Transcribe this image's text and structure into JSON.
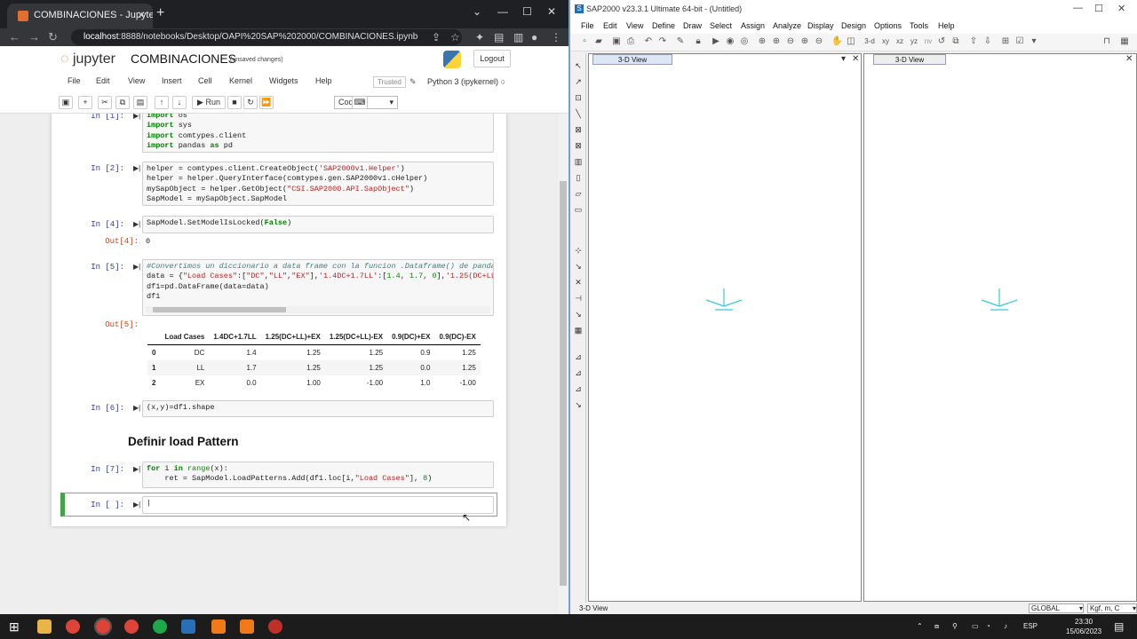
{
  "chrome": {
    "tab_title": "COMBINACIONES - Jupyter Note",
    "url_host": "localhost",
    "url_rest": ":8888/notebooks/Desktop/OAPI%20SAP%202000/COMBINACIONES.ipynb"
  },
  "jupyter": {
    "logo": "jupyter",
    "notebook_title": "COMBINACIONES",
    "save_status": "(unsaved changes)",
    "logout": "Logout",
    "menu": [
      "File",
      "Edit",
      "View",
      "Insert",
      "Cell",
      "Kernel",
      "Widgets",
      "Help"
    ],
    "trusted": "Trusted",
    "kernel": "Python 3 (ipykernel)",
    "run_label": "Run",
    "cell_type": "Code"
  },
  "cells": {
    "c1": {
      "prompt": "In [1]:"
    },
    "c2": {
      "prompt": "In [2]:"
    },
    "c4": {
      "prompt": "In [4]:",
      "out_prompt": "Out[4]:",
      "output": "0"
    },
    "c5": {
      "prompt": "In [5]:",
      "out_prompt": "Out[5]:"
    },
    "c6": {
      "prompt": "In [6]:"
    },
    "c7": {
      "prompt": "In [7]:"
    },
    "c8": {
      "prompt": "In [ ]:"
    }
  },
  "heading": "Definir load Pattern",
  "dataframe": {
    "columns": [
      "",
      "Load Cases",
      "1.4DC+1.7LL",
      "1.25(DC+LL)+EX",
      "1.25(DC+LL)-EX",
      "0.9(DC)+EX",
      "0.9(DC)-EX"
    ],
    "rows": [
      [
        "0",
        "DC",
        "1.4",
        "1.25",
        "1.25",
        "0.9",
        "1.25"
      ],
      [
        "1",
        "LL",
        "1.7",
        "1.25",
        "1.25",
        "0.0",
        "1.25"
      ],
      [
        "2",
        "EX",
        "0.0",
        "1.00",
        "-1.00",
        "1.0",
        "-1.00"
      ]
    ]
  },
  "sap": {
    "title": "SAP2000 v23.3.1 Ultimate 64-bit - (Untitled)",
    "menu": [
      "File",
      "Edit",
      "View",
      "Define",
      "Draw",
      "Select",
      "Assign",
      "Analyze",
      "Display",
      "Design",
      "Options",
      "Tools",
      "Help"
    ],
    "view_tab_1": "3-D View",
    "view_tab_2": "3-D View",
    "status_left": "3-D View",
    "coord_system": "GLOBAL",
    "units": "Kgf, m, C"
  },
  "taskbar": {
    "time": "23:30",
    "date": "15/06/2023",
    "lang": "ESP"
  }
}
